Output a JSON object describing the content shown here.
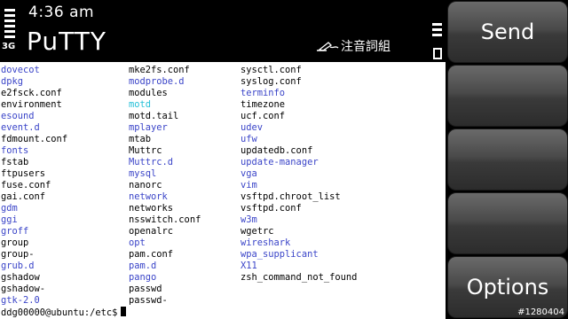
{
  "status": {
    "time": "4:36 am",
    "network": "3G",
    "signal_level": 0.8,
    "battery_level": 0.7
  },
  "app": {
    "title": "PuTTY",
    "input_mode": "注音詞組"
  },
  "colors": {
    "directory": "#3a44c8",
    "symlink": "#26c0d8",
    "file": "#000000"
  },
  "terminal": {
    "columns": [
      [
        {
          "name": "dovecot",
          "type": "dir"
        },
        {
          "name": "dpkg",
          "type": "dir"
        },
        {
          "name": "e2fsck.conf",
          "type": "file"
        },
        {
          "name": "environment",
          "type": "file"
        },
        {
          "name": "esound",
          "type": "dir"
        },
        {
          "name": "event.d",
          "type": "dir"
        },
        {
          "name": "fdmount.conf",
          "type": "file"
        },
        {
          "name": "fonts",
          "type": "dir"
        },
        {
          "name": "fstab",
          "type": "file"
        },
        {
          "name": "ftpusers",
          "type": "file"
        },
        {
          "name": "fuse.conf",
          "type": "file"
        },
        {
          "name": "gai.conf",
          "type": "file"
        },
        {
          "name": "gdm",
          "type": "dir"
        },
        {
          "name": "ggi",
          "type": "dir"
        },
        {
          "name": "groff",
          "type": "dir"
        },
        {
          "name": "group",
          "type": "file"
        },
        {
          "name": "group-",
          "type": "file"
        },
        {
          "name": "grub.d",
          "type": "dir"
        },
        {
          "name": "gshadow",
          "type": "file"
        },
        {
          "name": "gshadow-",
          "type": "file"
        },
        {
          "name": "gtk-2.0",
          "type": "dir"
        }
      ],
      [
        {
          "name": "mke2fs.conf",
          "type": "file"
        },
        {
          "name": "modprobe.d",
          "type": "dir"
        },
        {
          "name": "modules",
          "type": "file"
        },
        {
          "name": "motd",
          "type": "link"
        },
        {
          "name": "motd.tail",
          "type": "file"
        },
        {
          "name": "mplayer",
          "type": "dir"
        },
        {
          "name": "mtab",
          "type": "file"
        },
        {
          "name": "Muttrc",
          "type": "file"
        },
        {
          "name": "Muttrc.d",
          "type": "dir"
        },
        {
          "name": "mysql",
          "type": "dir"
        },
        {
          "name": "nanorc",
          "type": "file"
        },
        {
          "name": "network",
          "type": "dir"
        },
        {
          "name": "networks",
          "type": "file"
        },
        {
          "name": "nsswitch.conf",
          "type": "file"
        },
        {
          "name": "openalrc",
          "type": "file"
        },
        {
          "name": "opt",
          "type": "dir"
        },
        {
          "name": "pam.conf",
          "type": "file"
        },
        {
          "name": "pam.d",
          "type": "dir"
        },
        {
          "name": "pango",
          "type": "dir"
        },
        {
          "name": "passwd",
          "type": "file"
        },
        {
          "name": "passwd-",
          "type": "file"
        }
      ],
      [
        {
          "name": "sysctl.conf",
          "type": "file"
        },
        {
          "name": "syslog.conf",
          "type": "file"
        },
        {
          "name": "terminfo",
          "type": "dir"
        },
        {
          "name": "timezone",
          "type": "file"
        },
        {
          "name": "ucf.conf",
          "type": "file"
        },
        {
          "name": "udev",
          "type": "dir"
        },
        {
          "name": "ufw",
          "type": "dir"
        },
        {
          "name": "updatedb.conf",
          "type": "file"
        },
        {
          "name": "update-manager",
          "type": "dir"
        },
        {
          "name": "vga",
          "type": "dir"
        },
        {
          "name": "vim",
          "type": "dir"
        },
        {
          "name": "vsftpd.chroot_list",
          "type": "file"
        },
        {
          "name": "vsftpd.conf",
          "type": "file"
        },
        {
          "name": "w3m",
          "type": "dir"
        },
        {
          "name": "wgetrc",
          "type": "file"
        },
        {
          "name": "wireshark",
          "type": "dir"
        },
        {
          "name": "wpa_supplicant",
          "type": "dir"
        },
        {
          "name": "X11",
          "type": "dir"
        },
        {
          "name": "zsh_command_not_found",
          "type": "file"
        }
      ]
    ],
    "prompt": "ddg00000@ubuntu:/etc$"
  },
  "softkeys": {
    "top": "Send",
    "bottom": "Options"
  },
  "watermark": "#1280404"
}
